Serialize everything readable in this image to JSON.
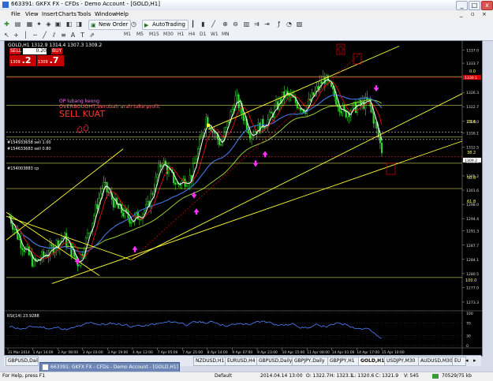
{
  "window": {
    "title": "663391: GKFX FX - CFDs - Demo Account - [GOLD,H1]",
    "min": "_",
    "max": "□",
    "close": "x"
  },
  "menu": [
    "File",
    "View",
    "Insert",
    "Charts",
    "Tools",
    "Window",
    "Help"
  ],
  "toolbar": {
    "new_order": "New Order",
    "autotrading": "AutoTrading",
    "timeframes": [
      "M1",
      "M5",
      "M15",
      "M30",
      "H1",
      "H4",
      "D1",
      "W1",
      "MN"
    ]
  },
  "chart": {
    "price_info": "GOLD,H1  1312.9 1314.4 1307.3 1309.2",
    "trade": {
      "sell": "SELL",
      "buy": "BUY",
      "lot": "0.20",
      "sell_price_small": "1309",
      "sell_price_big": ".2",
      "buy_price_small": "1309",
      "buy_price_big": ".7"
    },
    "annotations": {
      "line1": "OP lubang keong",
      "line2": "OVERBOUGHT,berubah arah take profit",
      "line3": "SELL KUAT"
    },
    "order_labels": [
      "#154933658 sell 1.00",
      "#154633683 sell 0.80",
      "#154003883 cp"
    ],
    "fib_labels": [
      "23.6",
      "38.2",
      "50.0",
      "61.8",
      "100.0",
      "0.0"
    ],
    "price_scale": [
      "1337.0",
      "1333.7",
      "1329.9",
      "1326.3",
      "1322.7",
      "1319.0",
      "1316.1",
      "1312.5",
      "1308.8",
      "1305.2",
      "1301.6",
      "1298.0",
      "1294.4",
      "1291.3",
      "1287.7",
      "1284.1",
      "1280.5",
      "1277.0",
      "1273.3"
    ],
    "current_price": "1309.2",
    "red_price": "1330.1",
    "rsi": {
      "label": "RSI(14) 23.9288",
      "levels": [
        "100",
        "70",
        "30",
        "0"
      ]
    },
    "time_axis": [
      "31 Mar 2014",
      "1 Apr 14:00",
      "2 Apr 08:00",
      "3 Apr 03:00",
      "3 Apr 19:00",
      "4 Apr 12:00",
      "7 Apr 05:00",
      "7 Apr 21:00",
      "8 Apr 14:00",
      "9 Apr 07:00",
      "9 Apr 23:00",
      "10 Apr 15:00",
      "11 Apr 08:00",
      "14 Apr 01:00",
      "14 Apr 17:00",
      "15 Apr 10:00"
    ]
  },
  "tabs": [
    "GBPUSD,Daily",
    "",
    "",
    "",
    "",
    "NZDUSD,H1",
    "EURUSD,H4",
    "GBPUSD,Daily",
    "GBPJPY,Daily",
    "GBPJPY,H1",
    "GOLD,H1",
    "USDJPY,M30",
    "AUDUSD,M30",
    "EU"
  ],
  "active_tab": "GOLD,H1",
  "tooltip": "663391: GKFX FX - CFDs - Demo Account - [GOLD,H1]",
  "status": {
    "help": "For Help, press F1",
    "profile": "Default",
    "datetime": "2014.04.14 13:00",
    "open": "O: 1322.7",
    "high": "H: 1323.1",
    "low": "L: 1320.6",
    "close": "C: 1321.9",
    "volume": "V: 545",
    "traffic": "70529/75 kb"
  },
  "colors": {
    "ma_blue": "#3f6fd8",
    "ma_white": "#ffffff",
    "ma_red": "#d01010",
    "ma_green": "#9acd32",
    "channel": "#ffff33",
    "annotation_red": "#ff3333",
    "annotation_magenta": "#ff66ff",
    "arrow_magenta": "#ff33ff"
  }
}
